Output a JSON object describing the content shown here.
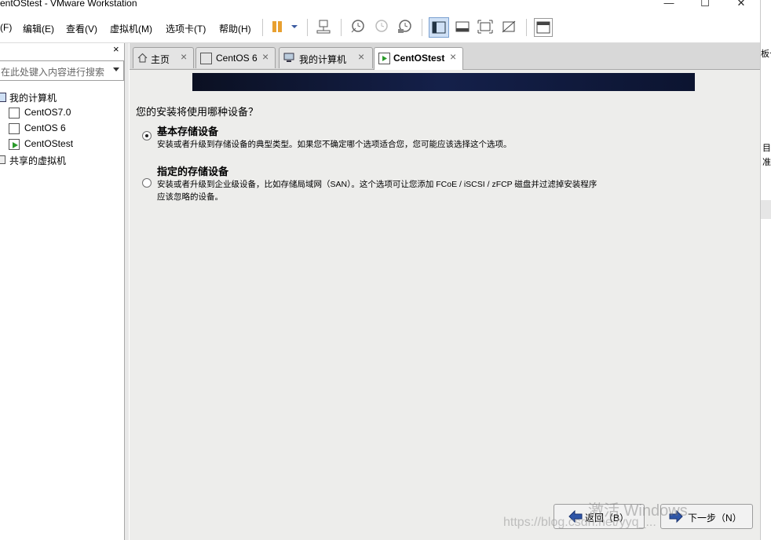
{
  "window": {
    "title": "entOStest - VMware Workstation",
    "minimize": "—",
    "maximize": "☐",
    "close": "✕"
  },
  "menu": [
    "(F)",
    "编辑(E)",
    "查看(V)",
    "虚拟机(M)",
    "选项卡(T)",
    "帮助(H)"
  ],
  "library": {
    "close": "×",
    "search_placeholder": "在此处键入内容进行搜索",
    "root": "我的计算机",
    "vms": [
      "CentOS7.0",
      "CentOS 6",
      "CentOStest"
    ],
    "shared": "共享的虚拟机"
  },
  "tabs": [
    {
      "label": "主页",
      "active": false
    },
    {
      "label": "CentOS 6",
      "active": false
    },
    {
      "label": "我的计算机",
      "active": false
    },
    {
      "label": "CentOStest",
      "active": true
    }
  ],
  "tab_close": "×",
  "installer": {
    "question": "您的安装将使用哪种设备？",
    "options": [
      {
        "title": "基本存储设备",
        "desc": [
          "安装或者升级到存储设备的典型类型。如果您不确定哪个选项适合您，您可能应该选择这个选项。"
        ],
        "selected": true
      },
      {
        "title": "指定的存储设备",
        "desc": [
          "安装或者升级到企业级设备，比如存储局域网（SAN）。这个选项可让您添加 FCoE / iSCSI / zFCP 磁盘并过滤掉安装程序",
          "应该忽略的设备。"
        ],
        "selected": false
      }
    ],
    "back_label": "返回（B）",
    "next_label": "下一步（N）"
  },
  "watermark": {
    "activate": "激活 Windows",
    "url": "https://blog.csdn.net/yyq_..."
  },
  "right_edge": [
    "板卡",
    "目",
    "准"
  ],
  "colors": {
    "banner": "#14204a",
    "content_bg": "#ededeb",
    "toolbar_accent": "#e8a030"
  }
}
